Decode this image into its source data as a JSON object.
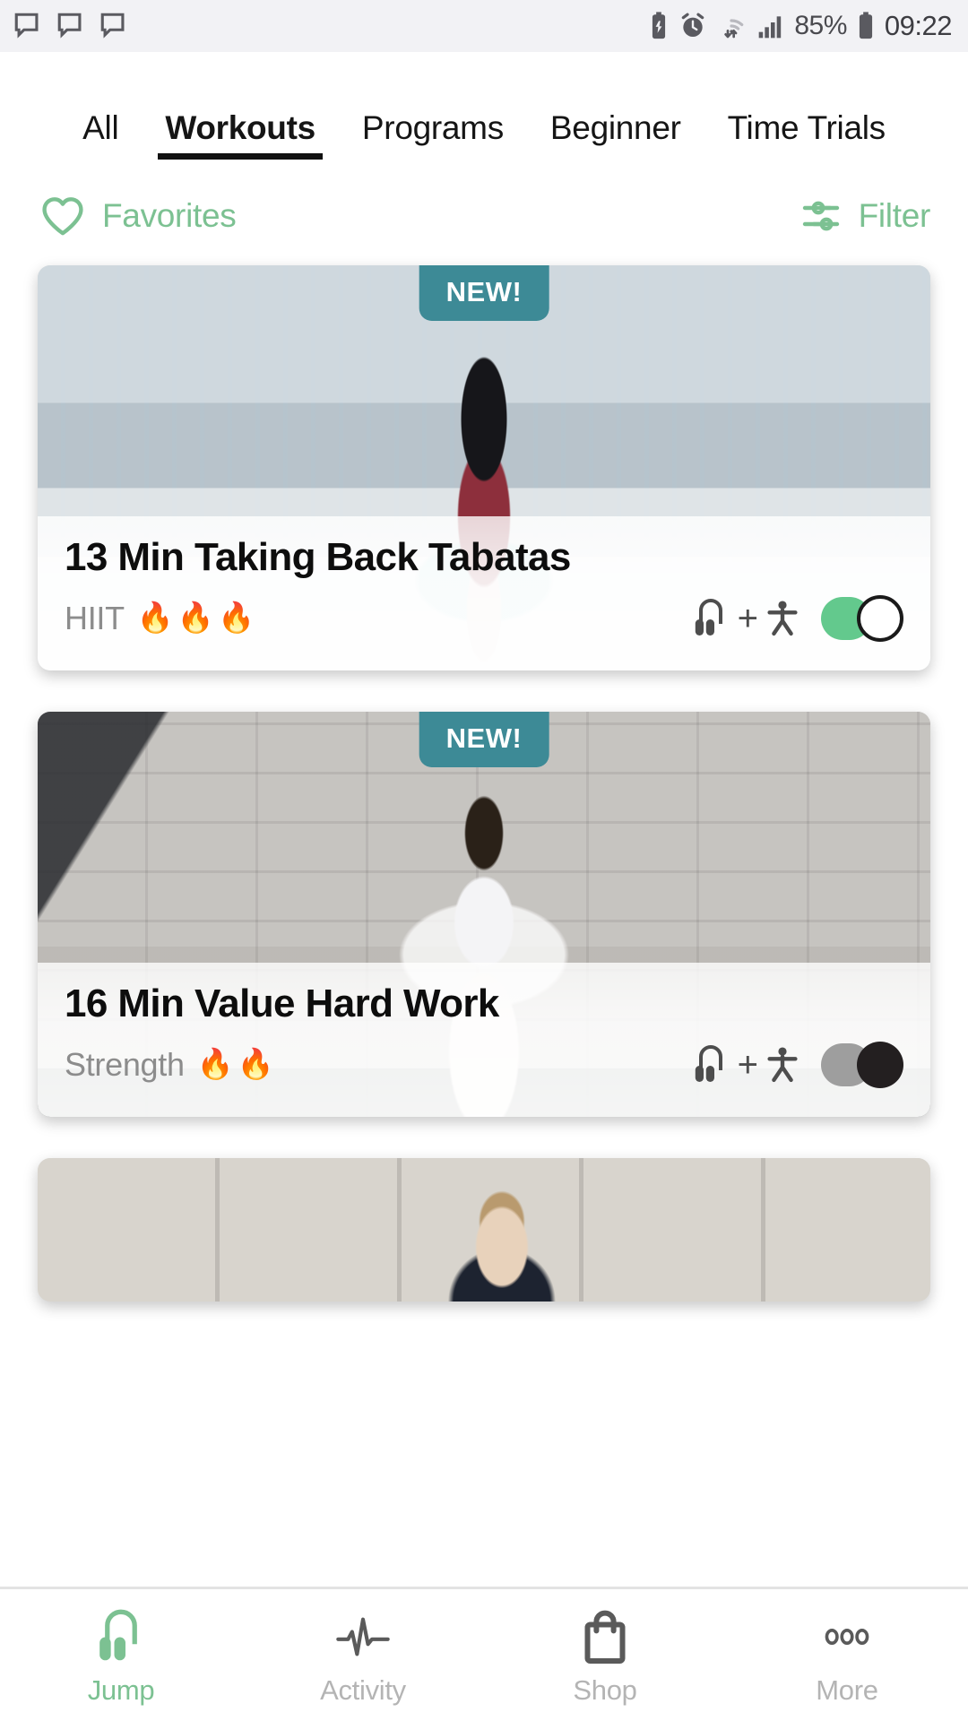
{
  "status_bar": {
    "left_icons": [
      "chat-bubble-icon",
      "chat-bubble-icon",
      "chat-bubble-icon"
    ],
    "right_icons": [
      "battery-saver-icon",
      "alarm-icon",
      "wifi-icon",
      "signal-icon",
      "battery-icon"
    ],
    "battery_percent": "85%",
    "clock": "09:22"
  },
  "tabs": [
    {
      "label": "All",
      "active": false
    },
    {
      "label": "Workouts",
      "active": true
    },
    {
      "label": "Programs",
      "active": false
    },
    {
      "label": "Beginner",
      "active": false
    },
    {
      "label": "Time Trials",
      "active": false
    }
  ],
  "utility_row": {
    "favorites_label": "Favorites",
    "favorites_icon": "heart-outline-icon",
    "filter_label": "Filter",
    "filter_icon": "sliders-icon",
    "accent_color": "#7cc192"
  },
  "cards": [
    {
      "badge": "NEW!",
      "title": "13 Min Taking Back Tabatas",
      "type": "HIIT",
      "intensity_flames": "🔥🔥🔥",
      "intensity_count": 3,
      "equipment_icons": [
        "jump-rope-icon",
        "plus-sign",
        "person-icon"
      ],
      "plus": "+",
      "toggle_state": "on",
      "toggle_color": "#63c98d",
      "image_alt": "woman-skipping-rope-on-glass-bridge"
    },
    {
      "badge": "NEW!",
      "title": "16 Min Value Hard Work",
      "type": "Strength",
      "intensity_flames": "🔥🔥",
      "intensity_count": 2,
      "equipment_icons": [
        "jump-rope-icon",
        "plus-sign",
        "person-icon"
      ],
      "plus": "+",
      "toggle_state": "off",
      "toggle_color": "#231f20",
      "image_alt": "woman-skipping-rope-against-white-wall"
    },
    {
      "badge": "",
      "title": "",
      "type": "",
      "intensity_flames": "",
      "intensity_count": 0,
      "equipment_icons": [],
      "plus": "",
      "toggle_state": "",
      "toggle_color": "",
      "image_alt": "woman-in-dark-jacket-against-concrete-wall"
    }
  ],
  "bottom_nav": [
    {
      "label": "Jump",
      "icon": "jump-rope-icon",
      "active": true
    },
    {
      "label": "Activity",
      "icon": "heartbeat-icon",
      "active": false
    },
    {
      "label": "Shop",
      "icon": "shopping-bag-icon",
      "active": false
    },
    {
      "label": "More",
      "icon": "three-dots-icon",
      "active": false
    }
  ]
}
